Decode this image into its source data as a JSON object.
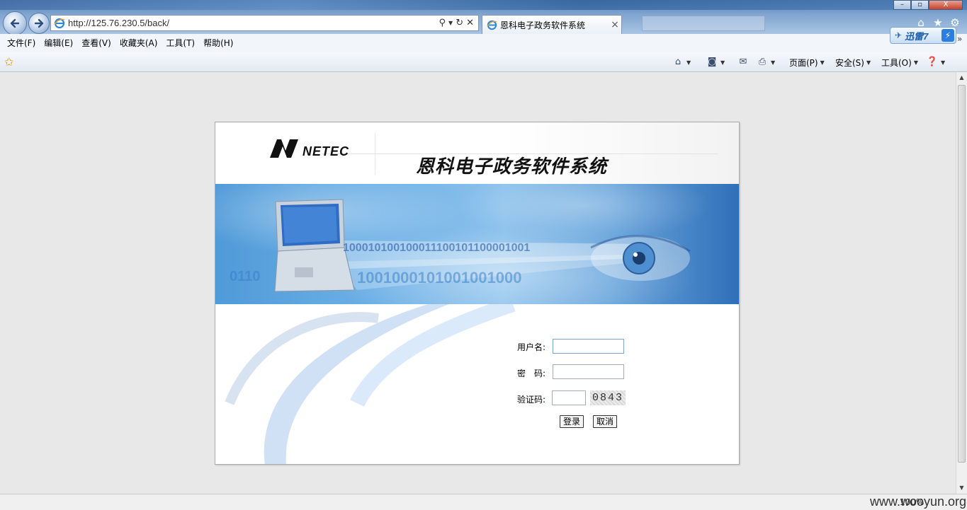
{
  "browser": {
    "url": "http://125.76.230.5/back/",
    "active_tab_title": "恩科电子政务软件系统",
    "tab_close": "×",
    "xunlei_label": "迅雷7",
    "menu": [
      "文件(F)",
      "编辑(E)",
      "查看(V)",
      "收藏夹(A)",
      "工具(T)",
      "帮助(H)"
    ],
    "menu_more": "»",
    "cmdbar": {
      "page_label": "页面(P)",
      "safety_label": "安全(S)",
      "tools_label": "工具(O)"
    },
    "window_controls": {
      "minimize": "–",
      "maximize": "▫",
      "close": "X"
    },
    "status": {
      "zoom": "100%"
    }
  },
  "page": {
    "logo_text": "NETEC",
    "system_title": "恩科电子政务软件系统",
    "banner_binary_1": "100010100100011100101100001001",
    "banner_binary_2": "1001000101001001000",
    "banner_binary_3": "0110",
    "form": {
      "username_label": "用户名:",
      "password_label": "密　码:",
      "captcha_label": "验证码:",
      "username_value": "",
      "password_value": "",
      "captcha_value": "",
      "captcha_code": "0843",
      "login_button": "登录",
      "cancel_button": "取消"
    }
  },
  "watermark": "www.wooyun.org",
  "colors": {
    "chrome_blue": "#7fa4cf",
    "banner_blue": "#4f9ad8",
    "page_bg": "#e8e8e8"
  }
}
